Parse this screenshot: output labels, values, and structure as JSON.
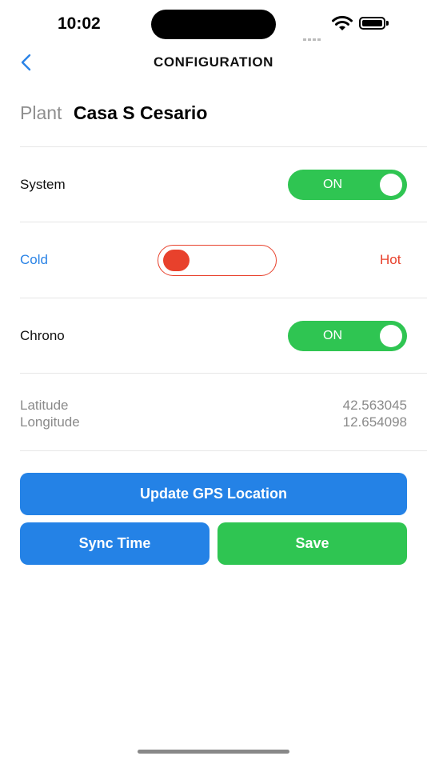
{
  "status_bar": {
    "time": "10:02"
  },
  "nav": {
    "title": "CONFIGURATION"
  },
  "plant": {
    "label": "Plant",
    "name": "Casa S Cesario"
  },
  "system": {
    "label": "System",
    "toggle_text": "ON",
    "state": true
  },
  "mode": {
    "cold_label": "Cold",
    "hot_label": "Hot",
    "selected": "Cold"
  },
  "chrono": {
    "label": "Chrono",
    "toggle_text": "ON",
    "state": true
  },
  "location": {
    "latitude_label": "Latitude",
    "latitude_value": "42.563045",
    "longitude_label": "Longitude",
    "longitude_value": "12.654098"
  },
  "buttons": {
    "update_gps": "Update GPS Location",
    "sync_time": "Sync Time",
    "save": "Save"
  },
  "colors": {
    "accent_blue": "#2482e6",
    "accent_green": "#2fc552",
    "accent_red": "#e8412c"
  }
}
